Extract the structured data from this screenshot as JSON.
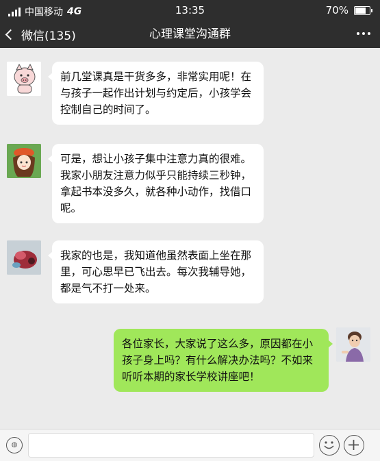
{
  "status_bar": {
    "carrier": "中国移动",
    "network": "4G",
    "time": "13:35",
    "battery": "70%",
    "battery_level": 0.7
  },
  "nav": {
    "back_label": "微信(135)",
    "title": "心理课堂沟通群"
  },
  "messages": [
    {
      "sender": "other",
      "text": "前几堂课真是干货多多，非常实用呢！在与孩子一起作出计划与约定后，小孩学会控制自己的时间了。"
    },
    {
      "sender": "other",
      "text": "可是，想让小孩子集中注意力真的很难。我家小朋友注意力似乎只能持续三秒钟，拿起书本没多久，就各种小动作，找借口呢。"
    },
    {
      "sender": "other",
      "text": "我家的也是，我知道他虽然表面上坐在那里，可心思早已飞出去。每次我辅导她，都是气不打一处来。"
    },
    {
      "sender": "me",
      "text": "各位家长，大家说了这么多，原因都在小孩子身上吗？有什么解决办法吗？不如来听听本期的家长学校讲座吧！"
    }
  ],
  "colors": {
    "header_bg": "#2e2e2e",
    "chat_bg": "#ebebeb",
    "my_bubble": "#a0e75a",
    "other_bubble": "#ffffff"
  }
}
